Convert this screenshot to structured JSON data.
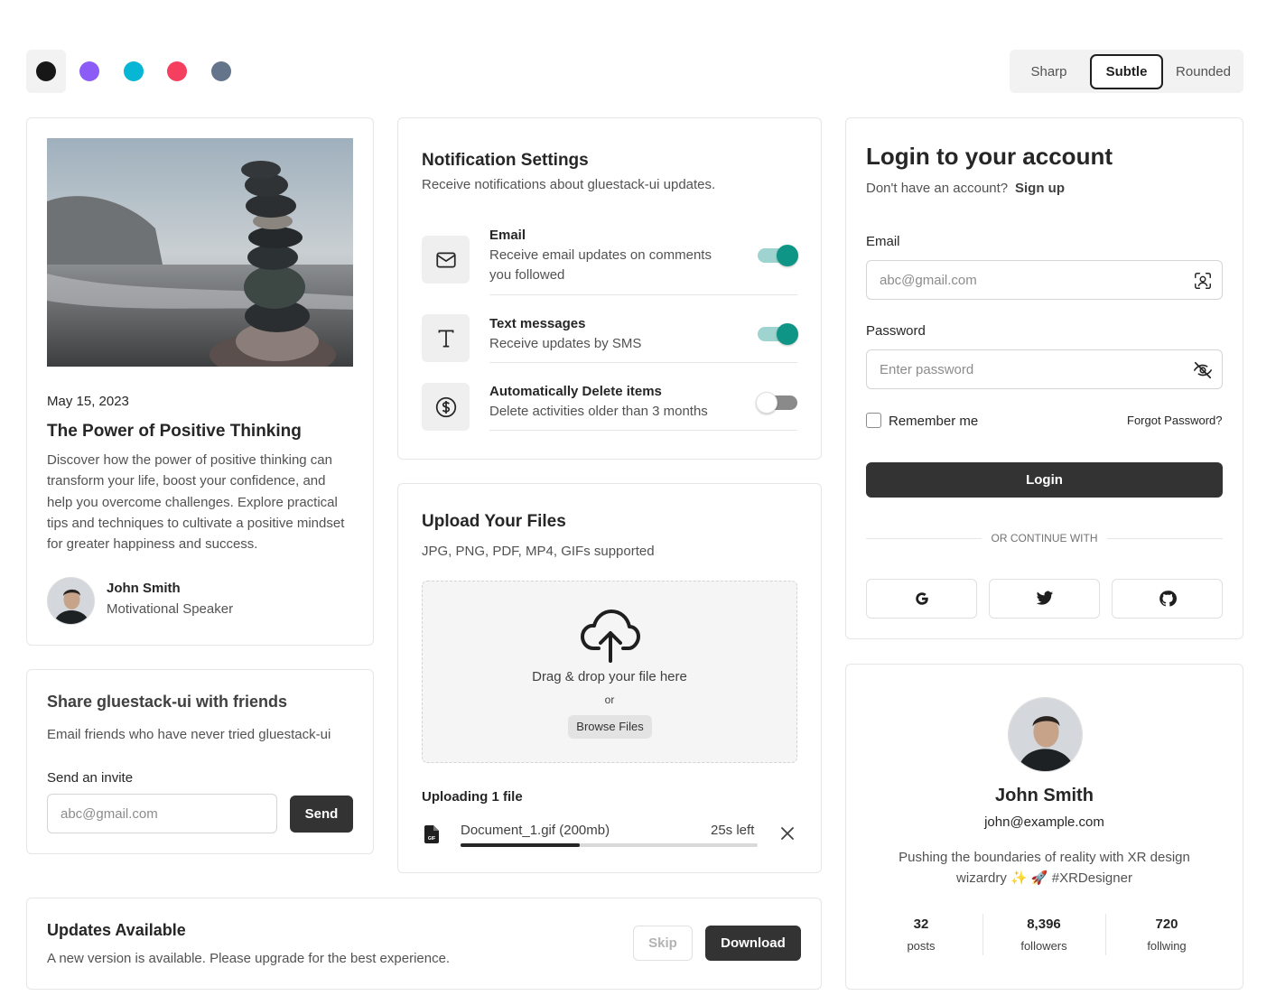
{
  "swatches": [
    {
      "name": "black",
      "color": "#171717"
    },
    {
      "name": "purple",
      "color": "#8b5cf6"
    },
    {
      "name": "cyan",
      "color": "#06b6d4"
    },
    {
      "name": "rose",
      "color": "#f43f5e"
    },
    {
      "name": "slate",
      "color": "#64748b"
    }
  ],
  "radius_options": [
    "Sharp",
    "Subtle",
    "Rounded"
  ],
  "radius_selected": "Subtle",
  "blog": {
    "date": "May 15, 2023",
    "title": "The Power of Positive Thinking",
    "body": "Discover how the power of positive thinking can transform your life, boost your confidence, and help you overcome challenges. Explore practical tips and techniques to cultivate a positive mindset for greater happiness and success.",
    "author_name": "John Smith",
    "author_role": "Motivational Speaker"
  },
  "share": {
    "title": "Share gluestack-ui with friends",
    "subtitle": "Email friends who have never tried gluestack-ui",
    "label": "Send an invite",
    "placeholder": "abc@gmail.com",
    "send_label": "Send"
  },
  "notifications": {
    "title": "Notification Settings",
    "subtitle": "Receive notifications about gluestack-ui updates.",
    "items": [
      {
        "title": "Email",
        "desc_line1": "Receive email updates on comments",
        "desc_line2": "you followed",
        "enabled": true,
        "icon": "mail-icon"
      },
      {
        "title": "Text messages",
        "desc_line1": "Receive updates by SMS",
        "enabled": true,
        "icon": "type-icon"
      },
      {
        "title": "Automatically Delete items",
        "desc_line1": "Delete activities older than 3 months",
        "enabled": false,
        "icon": "dollar-circle-icon"
      }
    ]
  },
  "upload": {
    "title": "Upload Your Files",
    "subtitle": "JPG, PNG, PDF, MP4, GIFs supported",
    "drop_text": "Drag & drop your file here",
    "or_text": "or",
    "browse_label": "Browse Files",
    "uploading_label": "Uploading 1 file",
    "file_name": "Document_1.gif (200mb)",
    "time_left": "25s left",
    "progress": 0.4
  },
  "updates": {
    "title": "Updates Available",
    "desc": "A new version is available. Please upgrade for the best experience.",
    "skip_label": "Skip",
    "download_label": "Download"
  },
  "login": {
    "title": "Login to your account",
    "no_account": "Don't have an account?",
    "signup_label": "Sign up",
    "email_label": "Email",
    "email_placeholder": "abc@gmail.com",
    "password_label": "Password",
    "password_placeholder": "Enter password",
    "remember_label": "Remember me",
    "forgot_label": "Forgot Password?",
    "login_label": "Login",
    "divider_text": "OR CONTINUE WITH"
  },
  "profile": {
    "name": "John Smith",
    "email": "john@example.com",
    "bio_line1": "Pushing the boundaries of reality with XR design",
    "bio_line2": "wizardry ✨ 🚀 #XRDesigner",
    "stats": [
      {
        "value": "32",
        "label": "posts"
      },
      {
        "value": "8,396",
        "label": "followers"
      },
      {
        "value": "720",
        "label": "follwing"
      }
    ]
  }
}
